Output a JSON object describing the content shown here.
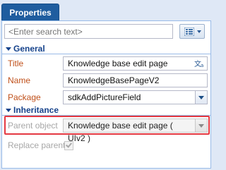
{
  "tabs": [
    {
      "label": "Properties",
      "active": true
    }
  ],
  "search": {
    "placeholder": "<Enter search text>"
  },
  "toolbar": {
    "menu_icon": "list-view-icon",
    "caret_icon": "chevron-down-icon"
  },
  "groups": {
    "general": {
      "title": "General",
      "fields": {
        "title": {
          "label": "Title",
          "value": "Knowledge base edit page",
          "icon": "localization-icon"
        },
        "name": {
          "label": "Name",
          "value": "KnowledgeBasePageV2"
        },
        "package": {
          "label": "Package",
          "value": "sdkAddPictureField"
        }
      }
    },
    "inheritance": {
      "title": "Inheritance",
      "fields": {
        "parent_object": {
          "label": "Parent object",
          "value": "Knowledge base edit page ( UIv2 )",
          "highlighted": true,
          "highlight_color": "#e43942"
        },
        "replace_parent": {
          "label": "Replace parent",
          "checked": true,
          "disabled": true
        }
      }
    }
  },
  "colors": {
    "tab_active": "#1f5d9f",
    "group_header": "#15428b",
    "field_label": "#c0501a",
    "highlight": "#e43942"
  }
}
